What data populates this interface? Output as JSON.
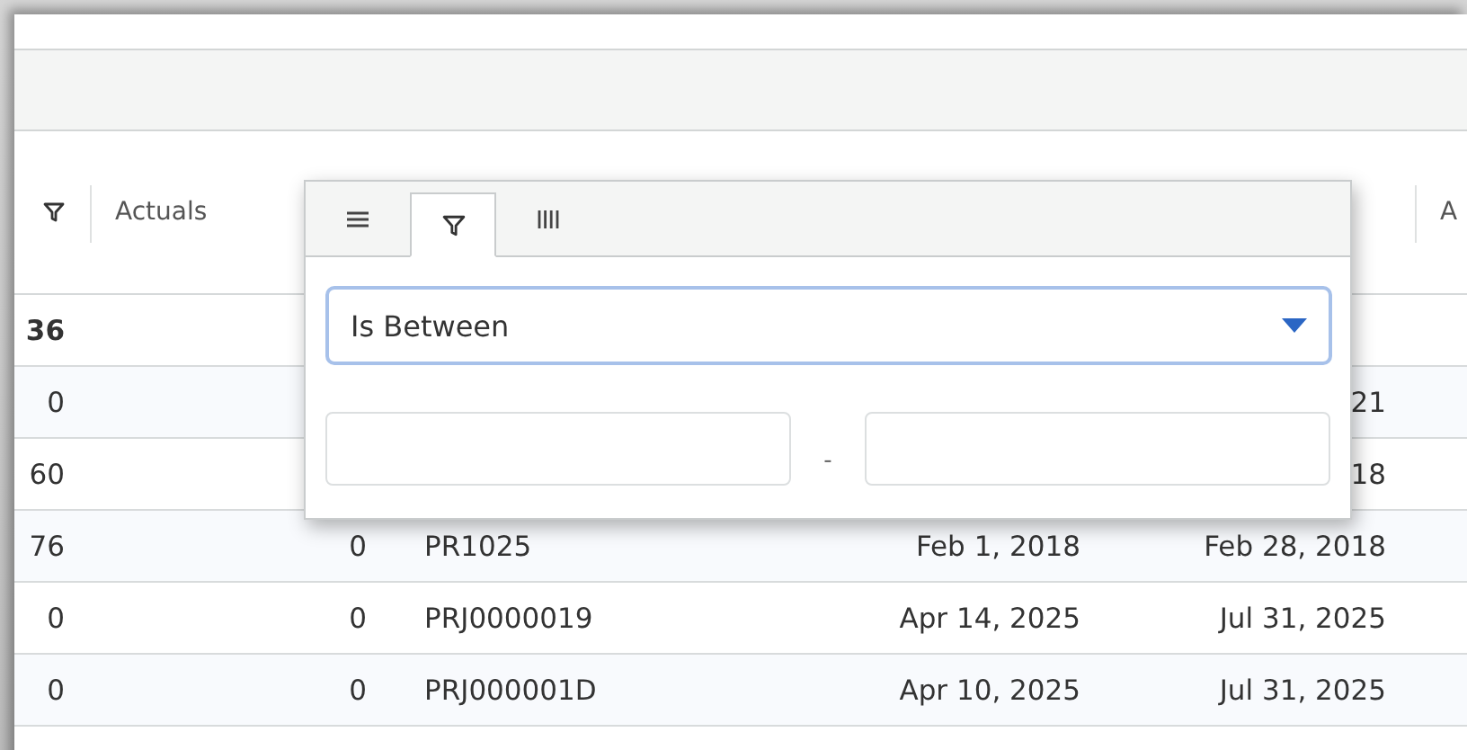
{
  "table": {
    "columns": [
      {
        "kind": "filter"
      },
      {
        "kind": "text",
        "label": "Actuals"
      },
      {
        "kind": "text"
      },
      {
        "kind": "text"
      },
      {
        "kind": "text"
      },
      {
        "kind": "text",
        "label": "A"
      }
    ],
    "rows": [
      {
        "total": true,
        "cells": [
          "36",
          null,
          null,
          null,
          null,
          null
        ]
      },
      {
        "total": false,
        "cells": [
          "0",
          null,
          null,
          null,
          "21",
          null
        ]
      },
      {
        "total": false,
        "cells": [
          "60",
          null,
          null,
          null,
          "18",
          null
        ]
      },
      {
        "total": false,
        "cells": [
          "76",
          "0",
          "PR1025",
          "Feb 1, 2018",
          "Feb 28, 2018",
          null
        ]
      },
      {
        "total": false,
        "cells": [
          "0",
          "0",
          "PRJ0000019",
          "Apr 14, 2025",
          "Jul 31, 2025",
          null
        ]
      },
      {
        "total": false,
        "cells": [
          "0",
          "0",
          "PRJ000001D",
          "Apr 10, 2025",
          "Jul 31, 2025",
          null
        ]
      }
    ]
  },
  "filter_popup": {
    "tabs": [
      {
        "kind": "menu",
        "selected": false
      },
      {
        "kind": "filter",
        "selected": true
      },
      {
        "kind": "columns",
        "selected": false
      }
    ],
    "condition": {
      "value": "Is Between"
    },
    "range_separator": "-"
  }
}
